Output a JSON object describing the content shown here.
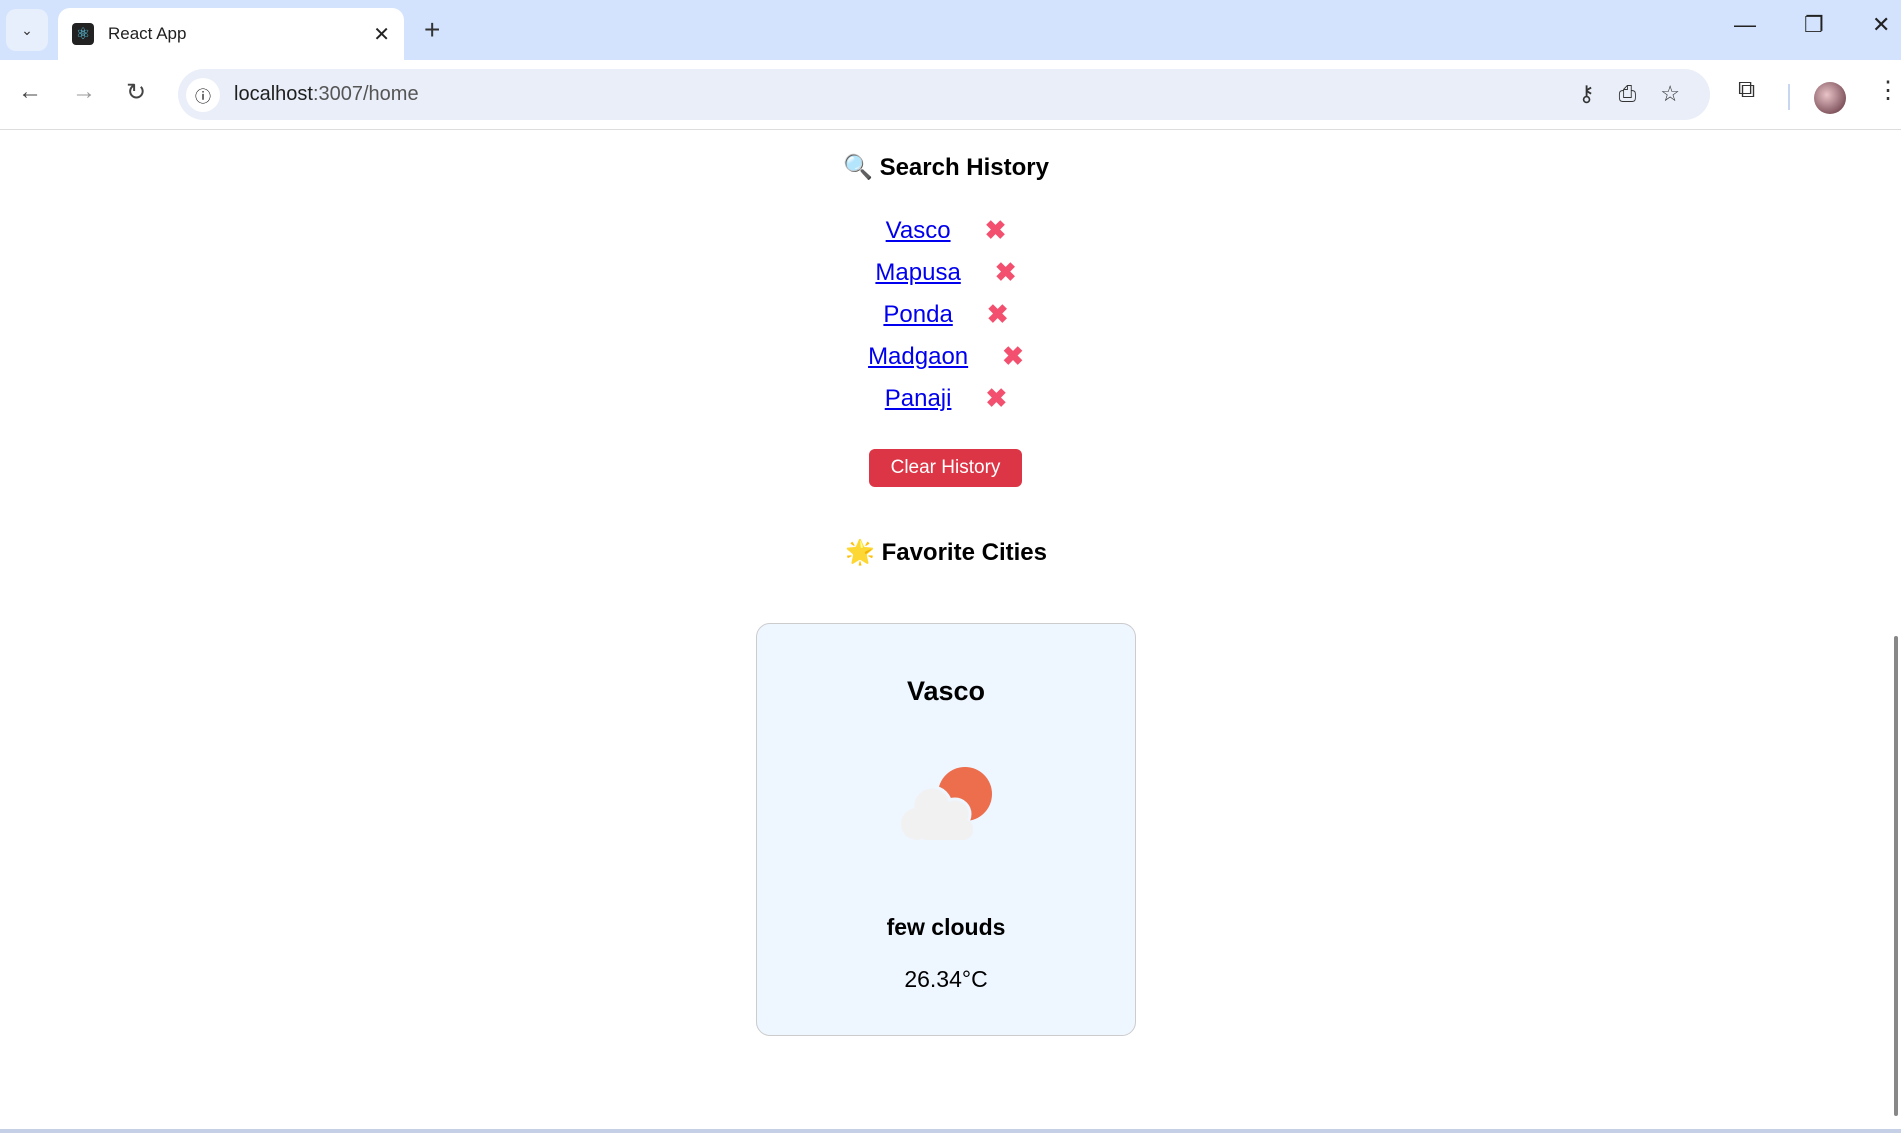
{
  "browser": {
    "tab_title": "React App",
    "url_host": "localhost",
    "url_path": ":3007/home",
    "icons": [
      "tab-search-icon",
      "react-favicon",
      "close-icon",
      "new-tab-icon",
      "minimize-icon",
      "restore-icon",
      "window-close-icon",
      "back-icon",
      "forward-icon",
      "reload-icon",
      "site-info-icon",
      "password-key-icon",
      "install-app-icon",
      "bookmark-star-icon",
      "extensions-icon",
      "profile-avatar",
      "menu-icon"
    ]
  },
  "search_history": {
    "icon": "🔍",
    "title": "Search History",
    "items": [
      "Vasco",
      "Mapusa",
      "Ponda",
      "Madgaon",
      "Panaji"
    ],
    "remove_icon": "✖",
    "clear_label": "Clear History",
    "clear_color": "#dc3545"
  },
  "favorites": {
    "icon": "🌟",
    "title": "Favorite Cities",
    "cards": [
      {
        "city": "Vasco",
        "icon": "few-clouds-icon",
        "description": "few clouds",
        "temperature": "26.34°C"
      }
    ]
  }
}
